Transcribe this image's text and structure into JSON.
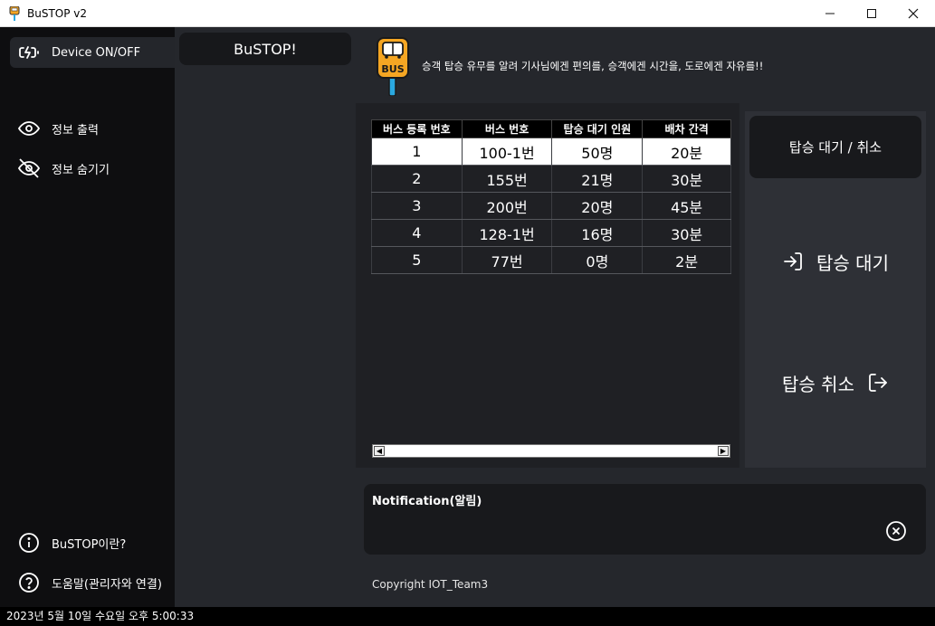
{
  "window": {
    "title": "BuSTOP v2",
    "minimize_icon": "minimize-icon",
    "maximize_icon": "maximize-icon",
    "close_icon": "close-icon"
  },
  "sidebar": {
    "items": [
      {
        "label": "Device ON/OFF",
        "icon": "battery-charging-icon"
      },
      {
        "label": "정보 출력",
        "icon": "eye-icon"
      },
      {
        "label": "정보 숨기기",
        "icon": "eye-off-icon"
      },
      {
        "label": "BuSTOP이란?",
        "icon": "info-icon"
      },
      {
        "label": "도움말(관리자와 연결)",
        "icon": "help-icon"
      }
    ]
  },
  "header": {
    "brand": "BuSTOP!",
    "logo_text": "BUS",
    "slogan": "승객 탑승 유무를 알려 기사님에겐 편의를, 승객에겐 시간을, 도로에겐 자유를!!"
  },
  "table": {
    "columns": [
      "버스 등록 번호",
      "버스 번호",
      "탑승 대기 인원",
      "배차 간격"
    ],
    "rows": [
      [
        "1",
        "100-1번",
        "50명",
        "20분"
      ],
      [
        "2",
        "155번",
        "21명",
        "30분"
      ],
      [
        "3",
        "200번",
        "20명",
        "45분"
      ],
      [
        "4",
        "128-1번",
        "16명",
        "30분"
      ],
      [
        "5",
        "77번",
        "0명",
        "2분"
      ]
    ],
    "selected_row": 0
  },
  "actions": {
    "toggle_label": "탑승 대기 / 취소",
    "wait_label": "탑승 대기",
    "cancel_label": "탑승 취소"
  },
  "notification": {
    "title": "Notification(알림)",
    "message": ""
  },
  "footer": {
    "copyright": "Copyright IOT_Team3"
  },
  "statusbar": {
    "datetime": "2023년 5월 10일 수요일 오후 5:00:33"
  },
  "colors": {
    "background": "#25272c",
    "sidebar": "#0e0e10",
    "logo_accent": "#f5a623",
    "logo_pole": "#2aa8e0"
  }
}
